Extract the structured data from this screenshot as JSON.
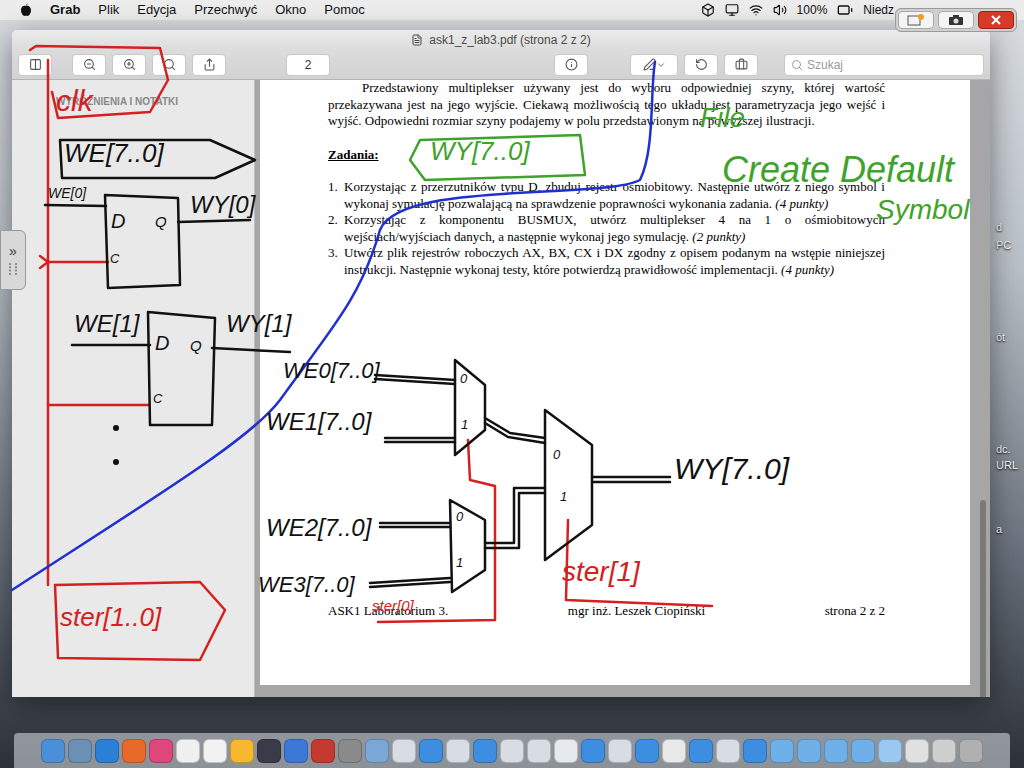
{
  "menubar": {
    "app": "Grab",
    "menus": [
      "Plik",
      "Edycja",
      "Przechwyć",
      "Okno",
      "Pomoc"
    ],
    "battery": "100%",
    "clock": "Niedz"
  },
  "window": {
    "title": "ask1_z_lab3.pdf (strona 2 z 2)",
    "page_field": "2",
    "search_placeholder": "Szukaj"
  },
  "sidebar": {
    "header": "WYRÓŻNIENIA I NOTATKI",
    "handle": "»"
  },
  "document": {
    "paragraph": "Przedstawiony multiplekser używany jest do wyboru odpowiedniej szyny, której wartość przekazywana jest na jego wyjście. Ciekawą możliwością tego układu jest parametryzacja jego wejść i wyjść. Odpowiedni rozmiar szyny podajemy w polu przedstawionym na powyższej ilustracji.",
    "heading": "Zadania:",
    "tasks": [
      {
        "number": "1.",
        "text": "Korzystając z przerzutników typu D, zbuduj rejestr ośmiobitowy. Następnie utwórz z niego symbol i wykonaj symulację pozwalającą na sprawdzenie poprawności wykonania zadania.",
        "points": "(4 punkty)"
      },
      {
        "number": "2.",
        "text": "Korzystając z komponentu BUSMUX, utwórz multiplekser 4 na 1 o ośmiobitowych wejściach/wyjściach danych, a następnie wykonaj jego symulację.",
        "points": "(2 punkty)"
      },
      {
        "number": "3.",
        "text": "Utwórz plik rejestrów roboczych AX, BX, CX i DX zgodny z opisem podanym na wstępie niniejszej instrukcji. Następnie wykonaj testy, które potwierdzą prawidłowość implementacji.",
        "points": "(4 punkty)"
      }
    ],
    "footer": [
      "ASK1 Laboratorium 3.",
      "mgr inż. Leszek Ciopiński",
      "strona 2 z 2"
    ]
  },
  "annotations": [
    {
      "text": "clk",
      "color": "#d42020"
    },
    {
      "text": "WE[7..0]",
      "color": "#111111"
    },
    {
      "text": "WE[0]",
      "color": "#111111"
    },
    {
      "text": "D",
      "color": "#111111"
    },
    {
      "text": "Q",
      "color": "#111111"
    },
    {
      "text": "C",
      "color": "#111111"
    },
    {
      "text": "WY[0]",
      "color": "#111111"
    },
    {
      "text": "WE[1]",
      "color": "#111111"
    },
    {
      "text": "WY[1]",
      "color": "#111111"
    },
    {
      "text": "D",
      "color": "#111111"
    },
    {
      "text": "Q",
      "color": "#111111"
    },
    {
      "text": "C",
      "color": "#111111"
    },
    {
      "text": "WY[7..0]",
      "color": "#3ea32a"
    },
    {
      "text": "File",
      "color": "#3ea32a"
    },
    {
      "text": "Create Default",
      "color": "#3ea32a"
    },
    {
      "text": "Symbol",
      "color": "#3ea32a"
    },
    {
      "text": "WE0[7..0]",
      "color": "#111111"
    },
    {
      "text": "WE1[7..0]",
      "color": "#111111"
    },
    {
      "text": "WE2[7..0]",
      "color": "#111111"
    },
    {
      "text": "WE3[7..0]",
      "color": "#111111"
    },
    {
      "text": "0",
      "color": "#111111"
    },
    {
      "text": "1",
      "color": "#111111"
    },
    {
      "text": "0",
      "color": "#111111"
    },
    {
      "text": "1",
      "color": "#111111"
    },
    {
      "text": "0",
      "color": "#111111"
    },
    {
      "text": "1",
      "color": "#111111"
    },
    {
      "text": "WY[7..0]",
      "color": "#111111"
    },
    {
      "text": "ster[1]",
      "color": "#d42020"
    },
    {
      "text": "ster[0]",
      "color": "#d42020"
    },
    {
      "text": "ster[1..0]",
      "color": "#d42020"
    }
  ],
  "desktop_labels": [
    "d",
    "PC",
    "ót",
    "dc.",
    "URL",
    "a"
  ]
}
